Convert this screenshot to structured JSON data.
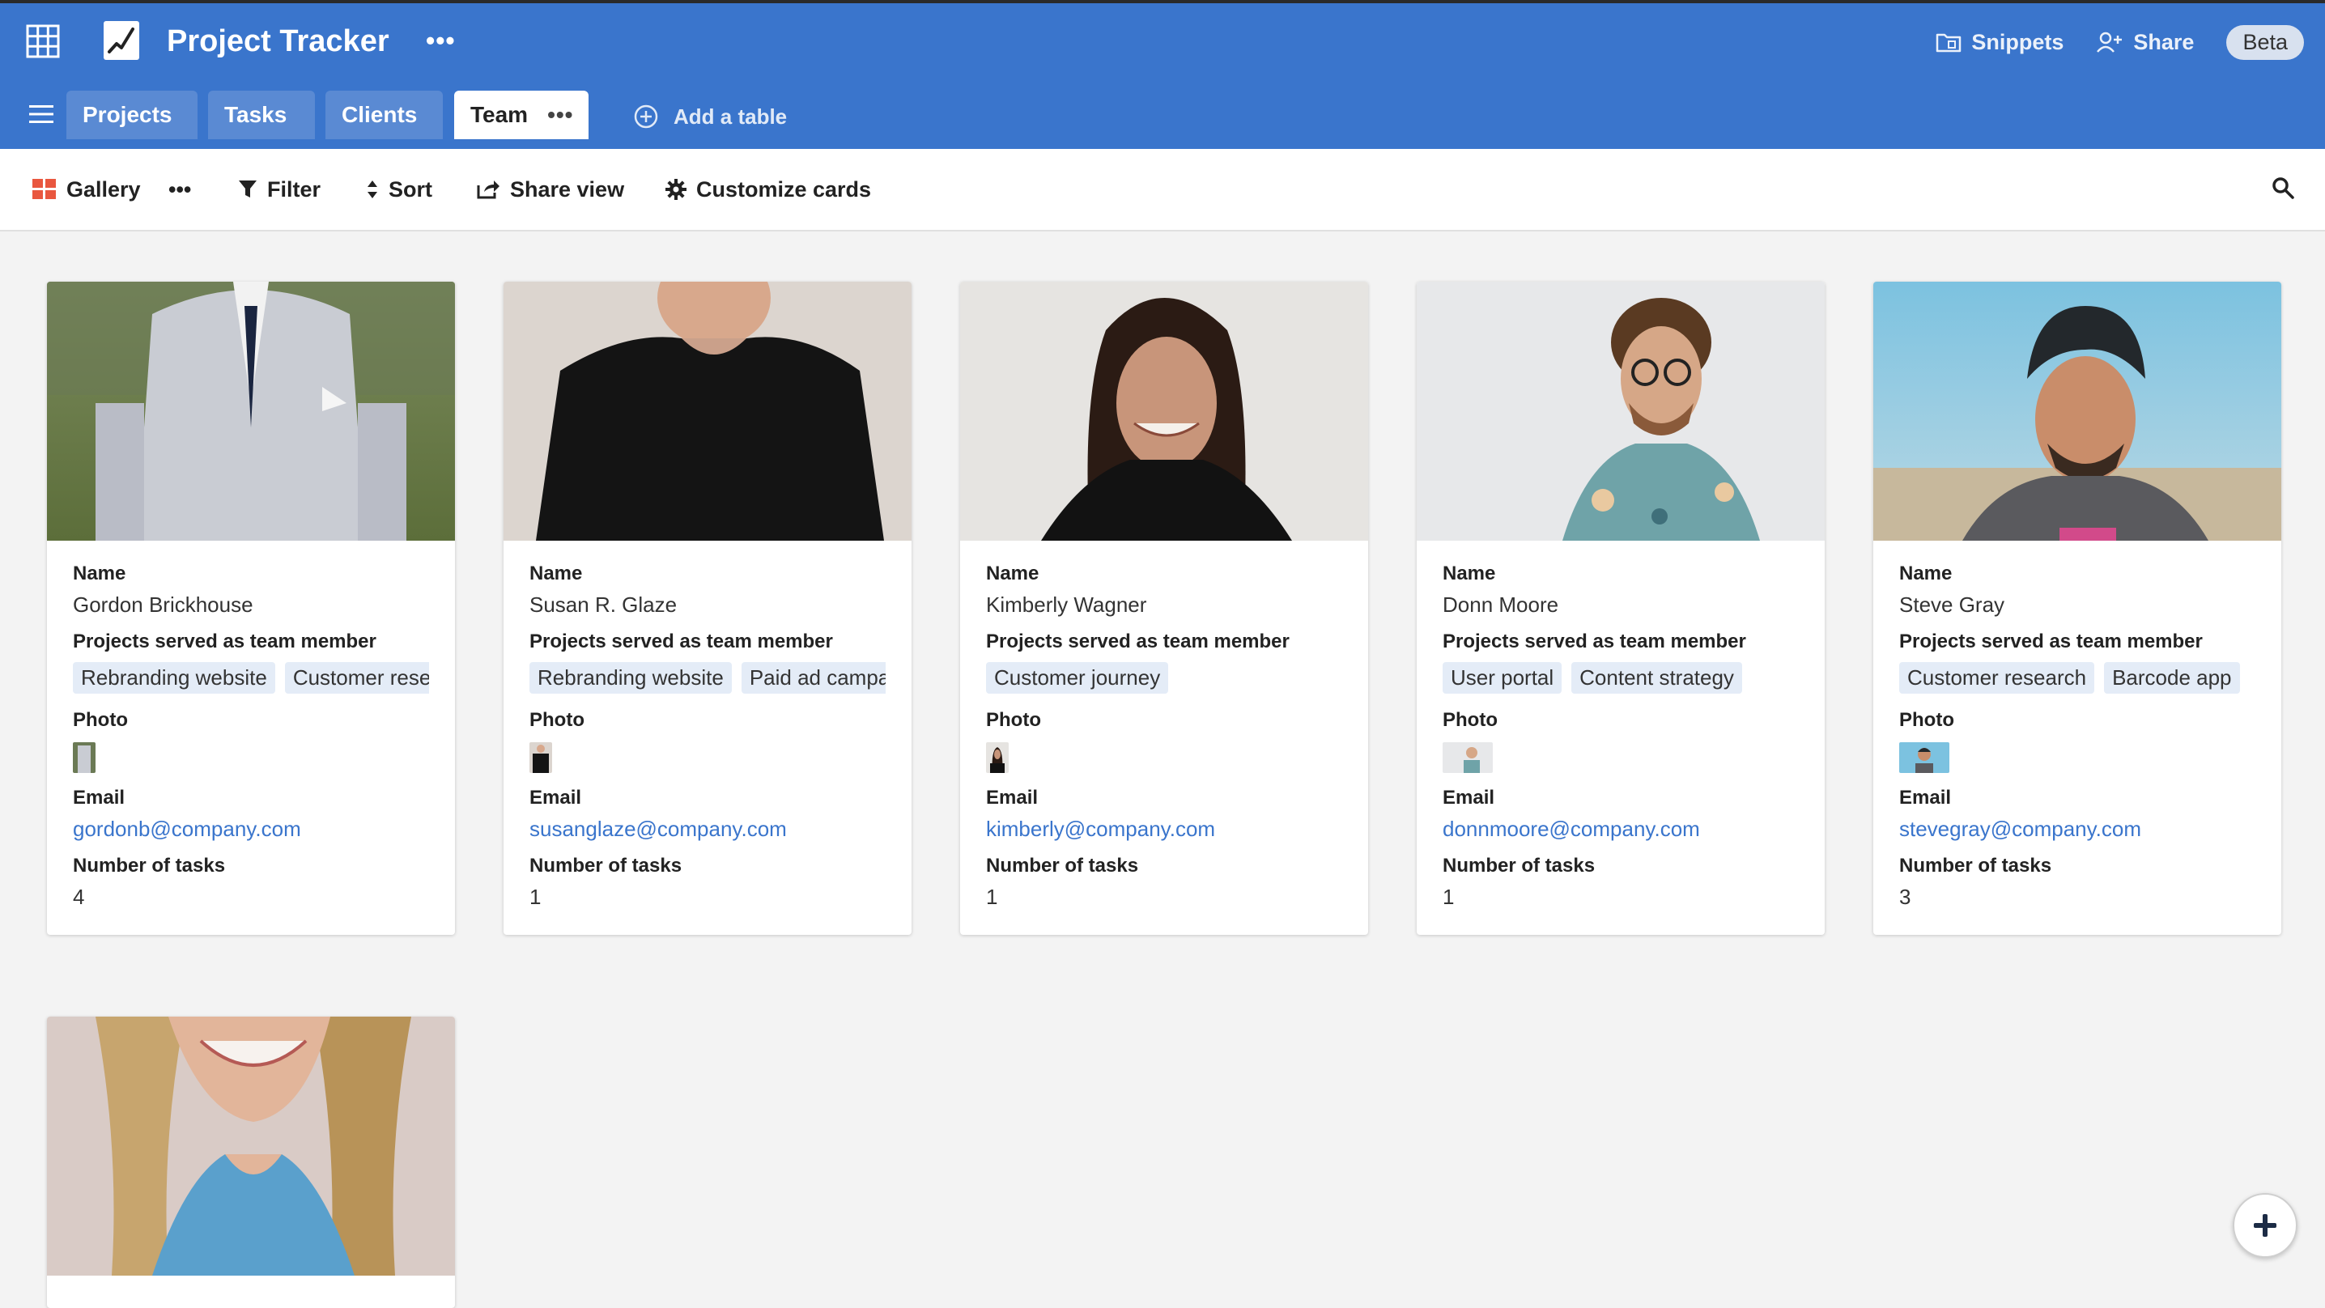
{
  "app": {
    "title": "Project Tracker",
    "accent": "#3a75cc",
    "icons": [
      "apps-grid-icon",
      "line-chart-icon",
      "more-dots-icon"
    ]
  },
  "top_right": {
    "snippets": "Snippets",
    "share": "Share",
    "beta": "Beta"
  },
  "tabs": [
    {
      "label": "Projects"
    },
    {
      "label": "Tasks"
    },
    {
      "label": "Clients"
    },
    {
      "label": "Team",
      "active": true,
      "more": "•••"
    }
  ],
  "add_table": "Add a table",
  "toolbar": {
    "view": "Gallery",
    "view_more": "•••",
    "filter": "Filter",
    "sort": "Sort",
    "share_view": "Share view",
    "customize": "Customize cards"
  },
  "field_labels": {
    "name": "Name",
    "projects": "Projects served as team member",
    "photo": "Photo",
    "email": "Email",
    "tasks": "Number of tasks"
  },
  "cards": [
    {
      "name": "Gordon Brickhouse",
      "projects": [
        "Rebranding website",
        "Customer research"
      ],
      "email": "gordonb@company.com",
      "tasks": "4"
    },
    {
      "name": "Susan R. Glaze",
      "projects": [
        "Rebranding website",
        "Paid ad campaign"
      ],
      "email": "susanglaze@company.com",
      "tasks": "1"
    },
    {
      "name": "Kimberly Wagner",
      "projects": [
        "Customer journey"
      ],
      "email": "kimberly@company.com",
      "tasks": "1"
    },
    {
      "name": "Donn Moore",
      "projects": [
        "User portal",
        "Content strategy"
      ],
      "email": "donnmoore@company.com",
      "tasks": "1"
    },
    {
      "name": "Steve Gray",
      "projects": [
        "Customer research",
        "Barcode app"
      ],
      "email": "stevegray@company.com",
      "tasks": "3"
    }
  ]
}
